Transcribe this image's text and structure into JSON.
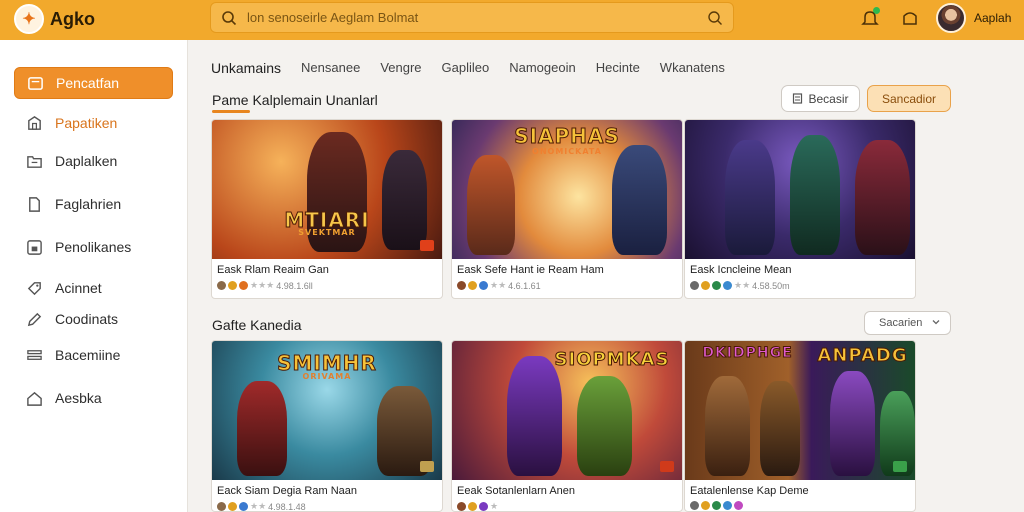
{
  "app": {
    "name": "Agko"
  },
  "search": {
    "placeholder": "lon senoseirle Aeglam Bolmat"
  },
  "user": {
    "name": "Aaplah"
  },
  "sidebar": {
    "items": [
      {
        "label": "Pencatfan",
        "icon": "folder-icon"
      },
      {
        "label": "Papatiken",
        "icon": "package-icon"
      },
      {
        "label": "Daplalken",
        "icon": "inbox-icon"
      },
      {
        "label": "Faglahrien",
        "icon": "document-icon"
      },
      {
        "label": "Penolikanes",
        "icon": "save-icon"
      },
      {
        "label": "Acinnet",
        "icon": "tag-icon"
      },
      {
        "label": "Coodinats",
        "icon": "pencil-icon"
      },
      {
        "label": "Bacemiine",
        "icon": "layers-icon"
      },
      {
        "label": "Aesbka",
        "icon": "home-icon"
      }
    ]
  },
  "tabs": [
    "Unkamains",
    "Nensanee",
    "Vengre",
    "Gaplileo",
    "Namogeoin",
    "Hecinte",
    "Wkanatens"
  ],
  "featured": {
    "title": "Pame  Kalplemain Unanlarl",
    "filter_label": "Becasir",
    "primary_label": "Sancadior"
  },
  "catalog": {
    "title": "Gafte Kanedia",
    "sort_label": "Sacarien"
  },
  "games_row1": [
    {
      "name": "Eask Rlam Reaim Gan",
      "rating": "4.98.1.6ll",
      "art_title": "MTIARI",
      "art_sub": "SVEKTMAR"
    },
    {
      "name": "Eask Sefe Hant ie Ream Ham",
      "rating": "4.6.1.61",
      "art_title": "SIAPHAS",
      "art_sub": "ONOMICKATA"
    },
    {
      "name": "Eask Icncleine Mean",
      "rating": "4.58.50m",
      "art_title": "",
      "art_sub": ""
    }
  ],
  "games_row2": [
    {
      "name": "Eack Siam Degia Ram Naan",
      "rating": "4.98.1.48",
      "art_title": "SMIMHR",
      "art_sub": "ORIVAMA"
    },
    {
      "name": "Eeak Sotanlenlarn Anen",
      "rating": "",
      "art_title": "SIOPMKAS",
      "art_sub": ""
    },
    {
      "name": "Eatalenlense Kap Deme",
      "rating": "",
      "art_title": "DKIDPHGE",
      "art_title2": "ANPADG",
      "art_sub": ""
    }
  ],
  "colors": {
    "topbar": "#f2a92c",
    "accent": "#ef8f2a",
    "notification": "#2fb84e"
  }
}
